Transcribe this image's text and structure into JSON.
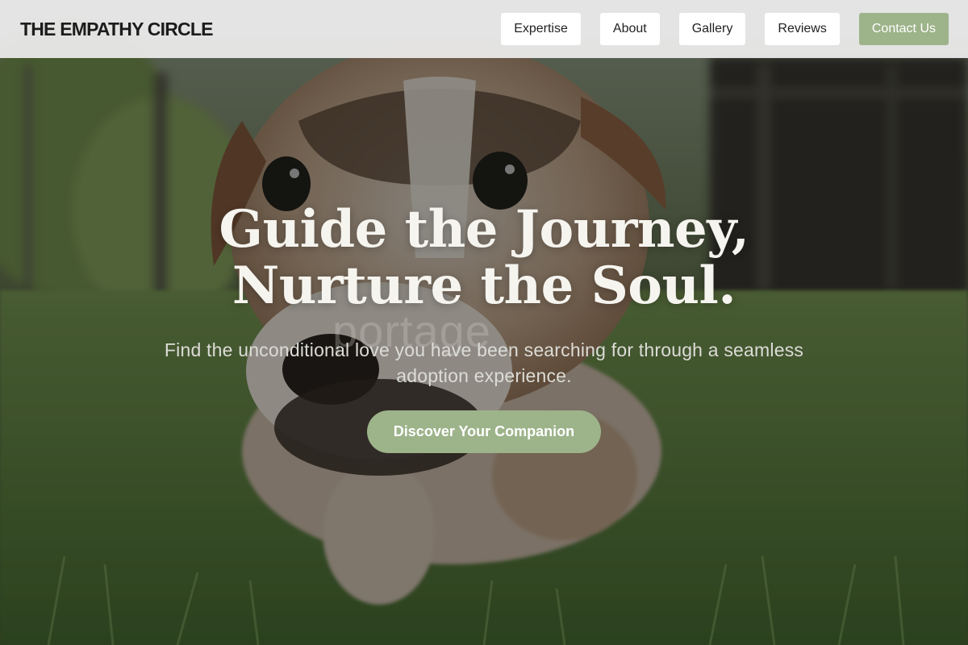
{
  "brand": {
    "name": "THE EMPATHY CIRCLE"
  },
  "nav": {
    "items": [
      {
        "label": "Expertise"
      },
      {
        "label": "About"
      },
      {
        "label": "Gallery"
      },
      {
        "label": "Reviews"
      }
    ],
    "cta_label": "Contact Us"
  },
  "hero": {
    "title_line1": "Guide the Journey,",
    "title_line2": "Nurture the Soul.",
    "watermark": "portage",
    "subtitle": "Find the unconditional love you have been searching for through a seamless adoption experience.",
    "cta_label": "Discover Your Companion",
    "image_subject": "puppy-in-grass-photo"
  },
  "colors": {
    "accent": "#9db38a",
    "nav_bg": "#eeeeee",
    "title_text": "#f6f4ef",
    "subtitle_text": "#dcdcd6"
  }
}
